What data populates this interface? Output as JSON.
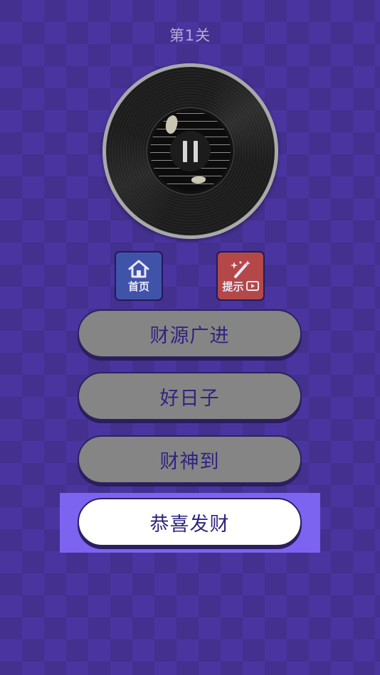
{
  "level": {
    "title": "第1关"
  },
  "record": {
    "state": "playing",
    "control_icon": "pause-icon"
  },
  "toolbar": {
    "home_label": "首页",
    "home_icon": "home-icon",
    "hint_label": "提示",
    "hint_icon": "magic-wand-icon",
    "hint_badge_icon": "video-icon"
  },
  "answers": [
    {
      "label": "财源广进",
      "selected": false
    },
    {
      "label": "好日子",
      "selected": false
    },
    {
      "label": "财神到",
      "selected": false
    },
    {
      "label": "恭喜发财",
      "selected": true
    }
  ],
  "colors": {
    "background": "#43308f",
    "answer_default": "#858585",
    "answer_selected": "#ffffff",
    "answer_text": "#2f2480",
    "highlight": "#7c63f0",
    "home_button": "#3f54a8",
    "hint_button": "#b44848"
  }
}
